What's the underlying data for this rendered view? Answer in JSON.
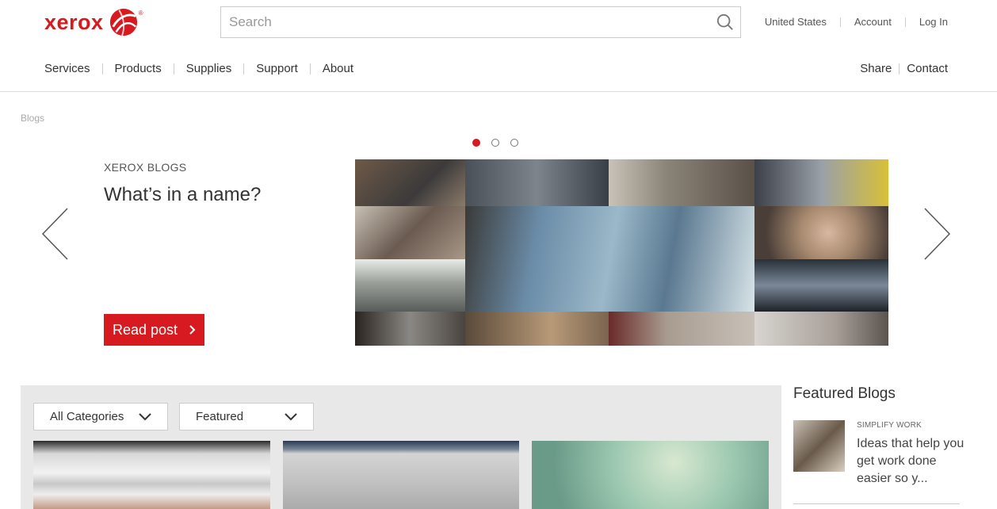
{
  "brand": {
    "name": "xerox",
    "reg": "®",
    "color": "#d71920"
  },
  "search": {
    "placeholder": "Search",
    "value": ""
  },
  "utility_nav": [
    "United States",
    "Account",
    "Log In"
  ],
  "main_nav": [
    "Services",
    "Products",
    "Supplies",
    "Support",
    "About"
  ],
  "right_nav": [
    "Share",
    "Contact"
  ],
  "breadcrumb": "Blogs",
  "carousel": {
    "slide_count": 3,
    "active_slide": 1,
    "eyebrow": "XEROX BLOGS",
    "title": "What’s in a name?",
    "cta_label": "Read post",
    "cta_color": "#d71920"
  },
  "filters": {
    "category": "All Categories",
    "sort": "Featured"
  },
  "featured_blogs": {
    "heading": "Featured Blogs",
    "items": [
      {
        "category": "SIMPLIFY WORK",
        "title": "Ideas that help you get work done easier so y..."
      }
    ]
  },
  "icons": {
    "search": "search-icon",
    "prev": "chevron-left-icon",
    "next": "chevron-right-icon",
    "dropdown": "chevron-down-icon",
    "cta": "chevron-right-icon"
  }
}
